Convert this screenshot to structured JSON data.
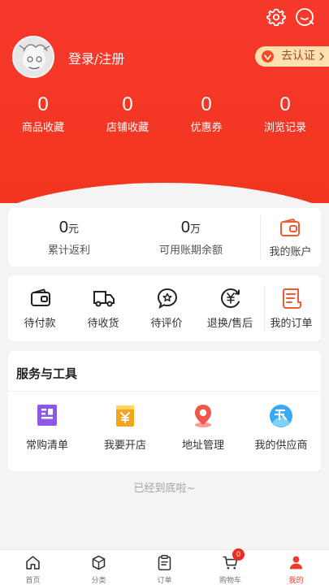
{
  "header": {
    "login_text": "登录/注册",
    "verify_text": "去认证"
  },
  "stats": [
    {
      "value": "0",
      "label": "商品收藏"
    },
    {
      "value": "0",
      "label": "店铺收藏"
    },
    {
      "value": "0",
      "label": "优惠券"
    },
    {
      "value": "0",
      "label": "浏览记录"
    }
  ],
  "finance": {
    "rebate": {
      "value": "0",
      "unit": "元",
      "label": "累计返利"
    },
    "credit": {
      "value": "0",
      "unit": "万",
      "label": "可用账期余额"
    },
    "account": {
      "label": "我的账户"
    }
  },
  "orders": [
    {
      "label": "待付款"
    },
    {
      "label": "待收货"
    },
    {
      "label": "待评价"
    },
    {
      "label": "退换/售后"
    },
    {
      "label": "我的订单"
    }
  ],
  "tools": {
    "title": "服务与工具",
    "items": [
      {
        "label": "常购清单"
      },
      {
        "label": "我要开店"
      },
      {
        "label": "地址管理"
      },
      {
        "label": "我的供应商"
      }
    ]
  },
  "bottom_note": "已经到底啦~",
  "tabbar": {
    "items": [
      {
        "label": "首页"
      },
      {
        "label": "分类"
      },
      {
        "label": "订单"
      },
      {
        "label": "购物车"
      },
      {
        "label": "我的"
      }
    ],
    "cart_count": "0"
  },
  "colors": {
    "primary": "#f33a28",
    "verify_bg": "#ffe0ae",
    "background": "#f4f4f4"
  }
}
